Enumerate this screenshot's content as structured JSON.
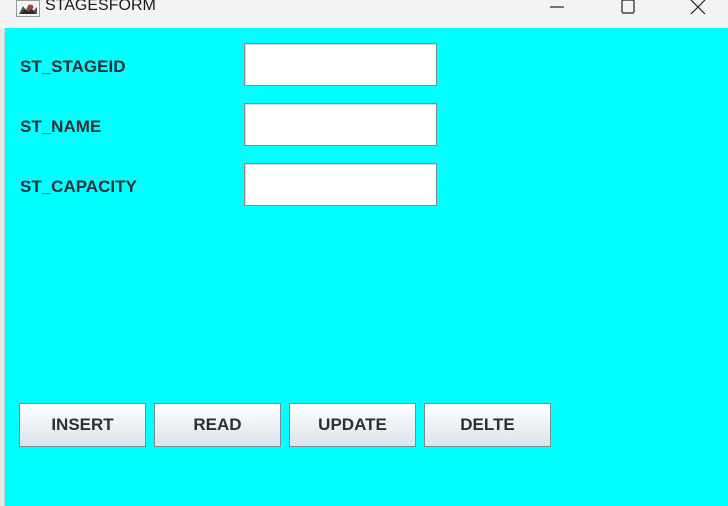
{
  "window": {
    "title": "STAGESFORM",
    "icons": {
      "app": "java-app-icon",
      "minimize": "minimize-icon",
      "maximize": "maximize-icon",
      "close": "close-icon"
    }
  },
  "colors": {
    "content_background": "#00ffff",
    "titlebar_background": "#f3f3f3",
    "label_text": "#2b2f36"
  },
  "form": {
    "fields": [
      {
        "label": "ST_STAGEID",
        "value": ""
      },
      {
        "label": "ST_NAME",
        "value": ""
      },
      {
        "label": "ST_CAPACITY",
        "value": ""
      }
    ],
    "buttons": {
      "insert": "INSERT",
      "read": "READ",
      "update": "UPDATE",
      "delete": "DELTE"
    }
  }
}
